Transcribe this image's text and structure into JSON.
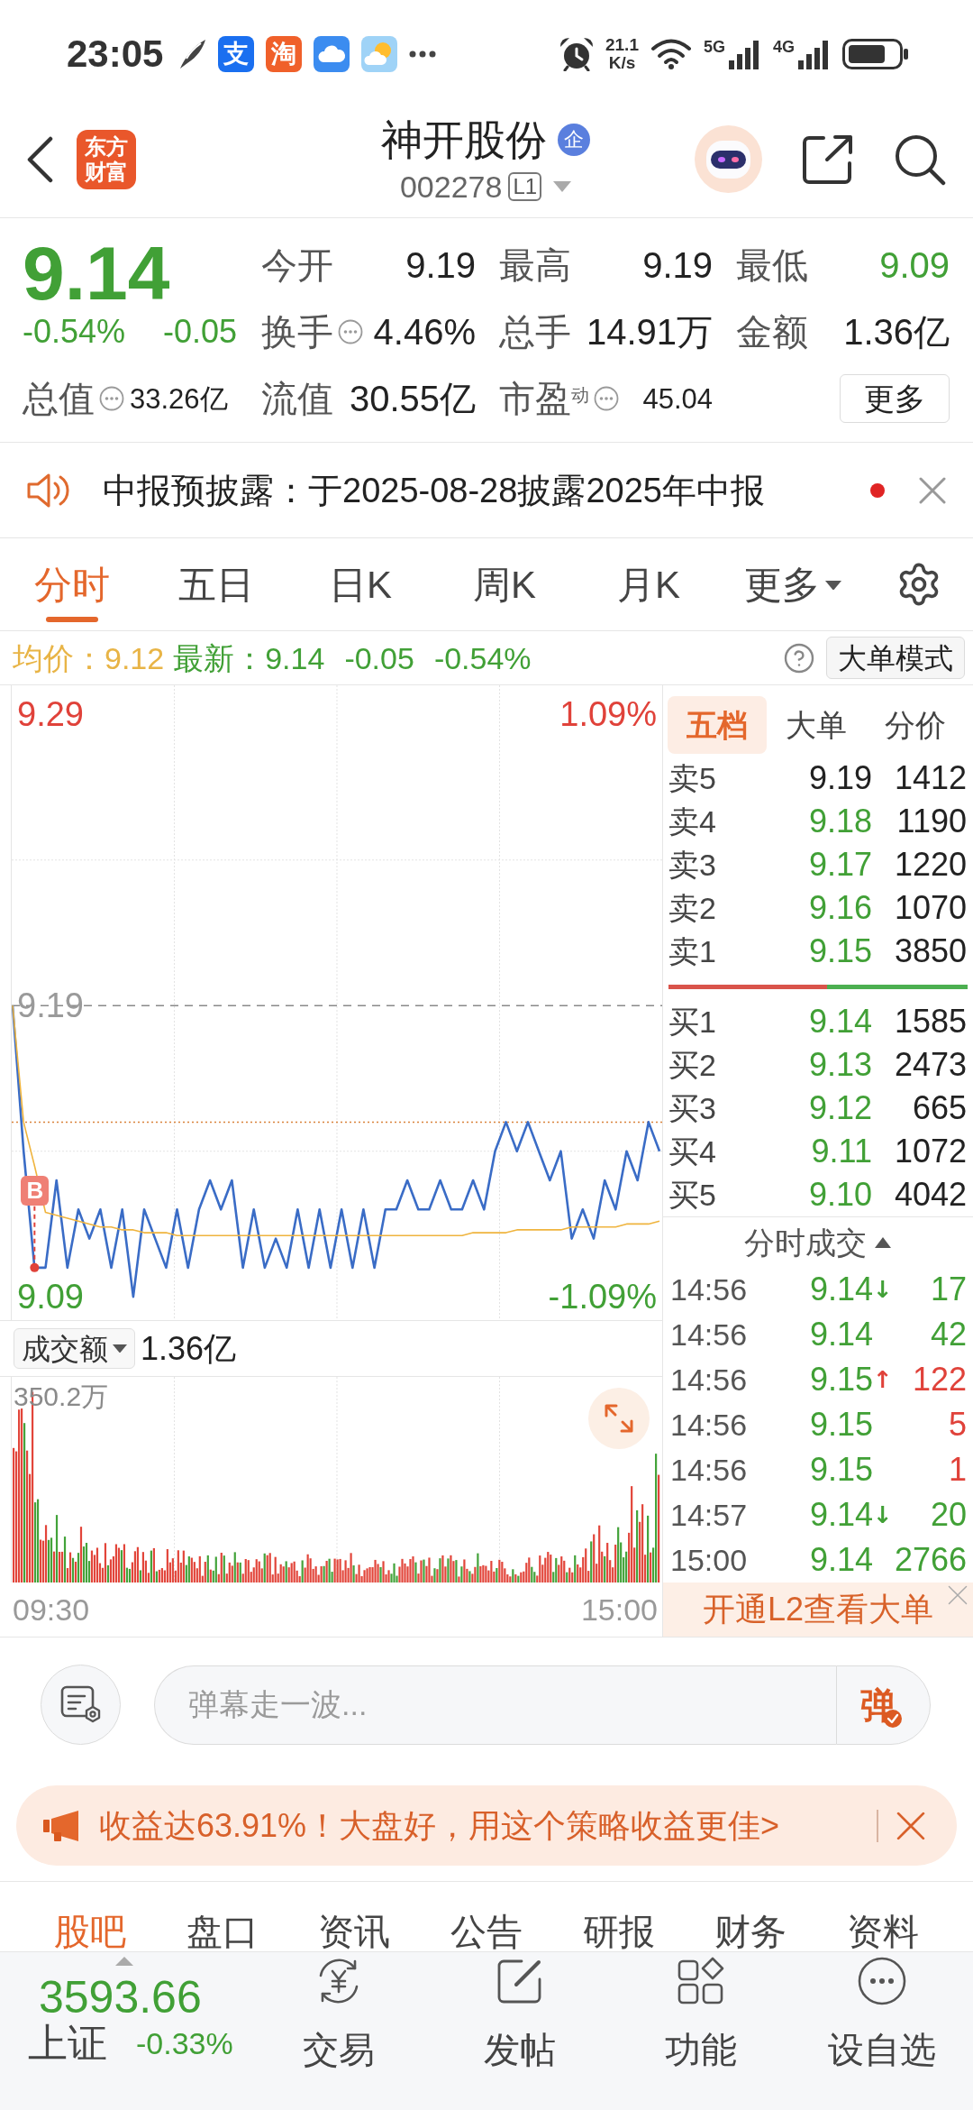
{
  "status_bar": {
    "time": "23:05",
    "app_tiles": [
      {
        "glyph": "支",
        "color": "#1a6ff0"
      },
      {
        "glyph": "淘",
        "color": "#f0602a"
      }
    ],
    "net_speed": "21.1",
    "net_unit": "K/s",
    "networks": [
      "5G",
      "4G"
    ]
  },
  "header": {
    "logo": "东方财富",
    "title": "神开股份",
    "title_tag": "企",
    "code": "002278",
    "level_tag": "L1"
  },
  "quote": {
    "price": "9.14",
    "falling": true,
    "change_pct": "-0.54%",
    "change": "-0.05",
    "total_value": {
      "label": "总值",
      "value": "33.26亿",
      "info": true
    },
    "stats": [
      {
        "label": "今开",
        "value": "9.19",
        "color": "#222222",
        "info": false
      },
      {
        "label": "最高",
        "value": "9.19",
        "color": "#222222",
        "info": false
      },
      {
        "label": "最低",
        "value": "9.09",
        "color": "#41a036",
        "info": false
      },
      {
        "label": "换手",
        "value": "4.46%",
        "color": "#222222",
        "info": true
      },
      {
        "label": "总手",
        "value": "14.91万",
        "color": "#222222",
        "info": false
      },
      {
        "label": "金额",
        "value": "1.36亿",
        "color": "#222222",
        "info": false
      },
      {
        "label": "流值",
        "value": "30.55亿",
        "color": "#222222",
        "info": false
      },
      {
        "label": "市盈",
        "sup": "动",
        "value": "45.04",
        "color": "#222222",
        "info": true
      }
    ],
    "more_button": "更多"
  },
  "notice": {
    "text": "中报预披露：于2025-08-28披露2025年中报",
    "unread": true
  },
  "chart_tabs": [
    {
      "label": "分时",
      "selected": true,
      "dropdown": false
    },
    {
      "label": "五日",
      "selected": false,
      "dropdown": false
    },
    {
      "label": "日K",
      "selected": false,
      "dropdown": false
    },
    {
      "label": "周K",
      "selected": false,
      "dropdown": false
    },
    {
      "label": "月K",
      "selected": false,
      "dropdown": false
    },
    {
      "label": "更多",
      "selected": false,
      "dropdown": true
    }
  ],
  "info_row": {
    "average": "均价：9.12",
    "latest": "最新：9.14",
    "falling": true,
    "change": "-0.05",
    "change_pct": "-0.54%",
    "mode_button": "大单模式"
  },
  "price_chart": {
    "pct_labels": [
      "1.09%",
      "-1.09%"
    ],
    "marker": {
      "text": "B"
    },
    "chart_data": {
      "type": "line",
      "ylim": [
        9.082,
        9.3
      ],
      "yticks": [
        9.09,
        9.19,
        9.29
      ],
      "series": [
        {
          "color": "#3a6cc6",
          "values": [
            9.19,
            9.14,
            9.1,
            9.1,
            9.13,
            9.1,
            9.12,
            9.11,
            9.12,
            9.1,
            9.12,
            9.09,
            9.12,
            9.11,
            9.1,
            9.12,
            9.1,
            9.12,
            9.13,
            9.12,
            9.13,
            9.1,
            9.12,
            9.1,
            9.11,
            9.1,
            9.12,
            9.1,
            9.12,
            9.1,
            9.12,
            9.1,
            9.12,
            9.1,
            9.12,
            9.12,
            9.13,
            9.12,
            9.12,
            9.13,
            9.12,
            9.12,
            9.13,
            9.12,
            9.14,
            9.15,
            9.14,
            9.15,
            9.14,
            9.13,
            9.14,
            9.11,
            9.12,
            9.11,
            9.13,
            9.12,
            9.14,
            9.13,
            9.15,
            9.14
          ]
        },
        {
          "color": "#efb43e",
          "values": [
            9.19,
            9.15,
            9.135,
            9.119,
            9.118,
            9.117,
            9.116,
            9.115,
            9.114,
            9.114,
            9.113,
            9.113,
            9.112,
            9.112,
            9.112,
            9.111,
            9.111,
            9.111,
            9.111,
            9.111,
            9.111,
            9.111,
            9.111,
            9.111,
            9.111,
            9.111,
            9.111,
            9.111,
            9.111,
            9.111,
            9.111,
            9.111,
            9.111,
            9.111,
            9.111,
            9.111,
            9.111,
            9.111,
            9.111,
            9.111,
            9.111,
            9.111,
            9.112,
            9.112,
            9.112,
            9.112,
            9.113,
            9.113,
            9.113,
            9.113,
            9.113,
            9.114,
            9.114,
            9.114,
            9.114,
            9.114,
            9.115,
            9.115,
            9.115,
            9.116
          ]
        }
      ],
      "ref_lines": [
        {
          "axis": "y",
          "value": 9.19,
          "color": "#8a8a8a"
        },
        {
          "axis": "y",
          "value": 9.15,
          "color": "#d9823b"
        }
      ]
    }
  },
  "volume_chart": {
    "selector": "成交额",
    "total": "1.36亿",
    "max_label": "350.2万",
    "time_axis": [
      "09:30",
      "15:00"
    ]
  },
  "order_book": {
    "tabs": [
      {
        "label": "五档",
        "selected": true
      },
      {
        "label": "大单",
        "selected": false
      },
      {
        "label": "分价",
        "selected": false
      }
    ],
    "asks": [
      {
        "label": "卖5",
        "price": "9.19",
        "volume": "1412",
        "color": "#222222"
      },
      {
        "label": "卖4",
        "price": "9.18",
        "volume": "1190",
        "color": "#41a036"
      },
      {
        "label": "卖3",
        "price": "9.17",
        "volume": "1220",
        "color": "#41a036"
      },
      {
        "label": "卖2",
        "price": "9.16",
        "volume": "1070",
        "color": "#41a036"
      },
      {
        "label": "卖1",
        "price": "9.15",
        "volume": "3850",
        "color": "#41a036"
      }
    ],
    "ratio_bar": {
      "level": 0.53
    },
    "bids": [
      {
        "label": "买1",
        "price": "9.14",
        "volume": "1585",
        "color": "#41a036"
      },
      {
        "label": "买2",
        "price": "9.13",
        "volume": "2473",
        "color": "#41a036"
      },
      {
        "label": "买3",
        "price": "9.12",
        "volume": "665",
        "color": "#41a036"
      },
      {
        "label": "买4",
        "price": "9.11",
        "volume": "1072",
        "color": "#41a036"
      },
      {
        "label": "买5",
        "price": "9.10",
        "volume": "4042",
        "color": "#41a036"
      }
    ]
  },
  "trades": {
    "title": "分时成交",
    "items": [
      {
        "time": "14:56",
        "price": "9.14",
        "arrow": "↓",
        "volume": "17",
        "color": "#41a036"
      },
      {
        "time": "14:56",
        "price": "9.14",
        "volume": "42",
        "color": "#41a036"
      },
      {
        "time": "14:56",
        "price": "9.15",
        "arrow": "↑",
        "volume": "122",
        "color": "#e0423a"
      },
      {
        "time": "14:56",
        "price": "9.15",
        "volume": "5",
        "color": "#e0423a"
      },
      {
        "time": "14:56",
        "price": "9.15",
        "volume": "1",
        "color": "#e0423a"
      },
      {
        "time": "14:57",
        "price": "9.14",
        "arrow": "↓",
        "volume": "20",
        "color": "#41a036"
      },
      {
        "time": "15:00",
        "price": "9.14",
        "volume": "2766",
        "color": "#41a036"
      }
    ]
  },
  "l2_banner": {
    "text": "开通L2查看大单"
  },
  "danmaku": {
    "placeholder": "弹幕走一波...",
    "send": "弹"
  },
  "promo": {
    "text": "收益达63.91%！大盘好，用这个策略收益更佳>"
  },
  "bottom_tabs": [
    {
      "label": "股吧",
      "selected": true
    },
    {
      "label": "盘口",
      "selected": false
    },
    {
      "label": "资讯",
      "selected": false
    },
    {
      "label": "公告",
      "selected": false
    },
    {
      "label": "研报",
      "selected": false
    },
    {
      "label": "财务",
      "selected": false
    },
    {
      "label": "资料",
      "selected": false
    }
  ],
  "bottom_nav": {
    "index": {
      "value": "3593.66",
      "name": "上证",
      "change": "-0.33%",
      "falling": true
    },
    "items": [
      {
        "label": "交易"
      },
      {
        "label": "发帖"
      },
      {
        "label": "功能"
      },
      {
        "label": "设自选"
      }
    ]
  }
}
